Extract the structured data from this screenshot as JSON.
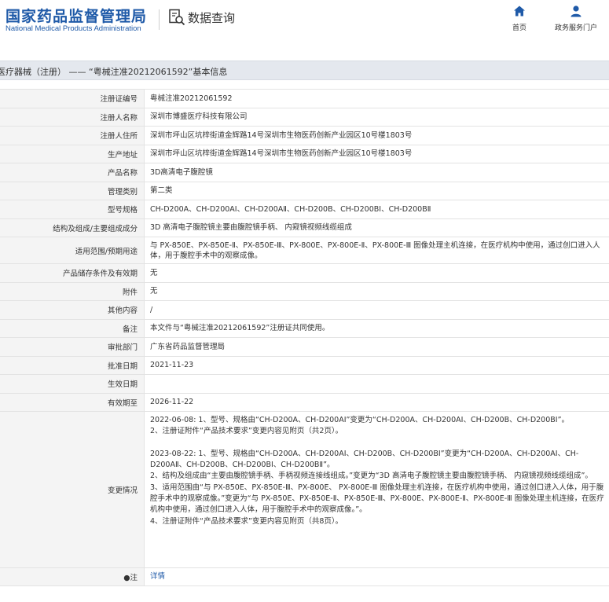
{
  "header": {
    "logo_cn": "国家药品监督管理局",
    "logo_en": "National Medical Products Administration",
    "query_label": "数据查询",
    "nav": [
      {
        "label": "首页",
        "icon": "home-icon"
      },
      {
        "label": "政务服务门户",
        "icon": "user-icon"
      }
    ],
    "brand_color": "#1f5aa8"
  },
  "title": "医疗器械（注册） —— “粤械注准20212061592”基本信息",
  "rows": [
    {
      "label": "注册证编号",
      "value": "粤械注准20212061592"
    },
    {
      "label": "注册人名称",
      "value": "深圳市博盛医疗科技有限公司"
    },
    {
      "label": "注册人住所",
      "value": "深圳市坪山区坑梓街道金辉路14号深圳市生物医药创新产业园区10号楼1803号"
    },
    {
      "label": "生产地址",
      "value": "深圳市坪山区坑梓街道金辉路14号深圳市生物医药创新产业园区10号楼1803号"
    },
    {
      "label": "产品名称",
      "value": "3D高清电子腹腔镜"
    },
    {
      "label": "管理类别",
      "value": "第二类"
    },
    {
      "label": "型号规格",
      "value": "CH-D200A、CH-D200AⅠ、CH-D200AⅡ、CH-D200B、CH-D200BⅠ、CH-D200BⅡ"
    },
    {
      "label": "结构及组成/主要组成成分",
      "value": "3D 高清电子腹腔镜主要由腹腔镜手柄、 内窥镜视频线缆组成"
    },
    {
      "label": "适用范围/预期用途",
      "value": "与 PX-850E、PX-850E-Ⅱ、PX-850E-Ⅲ、PX-800E、PX-800E-Ⅱ、PX-800E-Ⅲ 图像处理主机连接，在医疗机构中使用，通过创口进入人体，用于腹腔手术中的观察成像。"
    },
    {
      "label": "产品储存条件及有效期",
      "value": "无"
    },
    {
      "label": "附件",
      "value": "无"
    },
    {
      "label": "其他内容",
      "value": "/"
    },
    {
      "label": "备注",
      "value": "本文件与“粤械注准20212061592”注册证共同使用。"
    },
    {
      "label": "审批部门",
      "value": "广东省药品监督管理局"
    },
    {
      "label": "批准日期",
      "value": "2021-11-23"
    },
    {
      "label": "生效日期",
      "value": ""
    },
    {
      "label": "有效期至",
      "value": "2026-11-22"
    }
  ],
  "changes": {
    "label": "变更情况",
    "paragraphs": [
      "2022-06-08: 1、型号、规格由“CH-D200A、CH-D200AⅠ”变更为“CH-D200A、CH-D200AⅠ、CH-D200B、CH-D200BⅠ”。",
      "2、注册证附件“产品技术要求”变更内容见附页（共2页）。",
      "",
      "2023-08-22: 1、型号、规格由“CH-D200A、CH-D200AⅠ、CH-D200B、CH-D200BⅠ”变更为“CH-D200A、CH-D200AⅠ、CH-D200AⅡ、CH-D200B、CH-D200BⅠ、CH-D200BⅡ”。",
      "2、结构及组成由“主要由腹腔镜手柄、手柄视频连接线组成。”变更为“3D 高清电子腹腔镜主要由腹腔镜手柄、 内窥镜视频线缆组成”。",
      "3、适用范围由“与 PX-850E、PX-850E-Ⅲ、PX-800E、 PX-800E-Ⅲ 图像处理主机连接，在医疗机构中使用，通过创口进入人体，用于腹腔手术中的观察成像。”变更为“与 PX-850E、PX-850E-Ⅱ、PX-850E-Ⅲ、PX-800E、PX-800E-Ⅱ、PX-800E-Ⅲ 图像处理主机连接，在医疗机构中使用，通过创口进入人体，用于腹腔手术中的观察成像。”。",
      "4、注册证附件“产品技术要求”变更内容见附页（共8页）。"
    ]
  },
  "note": {
    "label": "●注",
    "link": "详情"
  }
}
